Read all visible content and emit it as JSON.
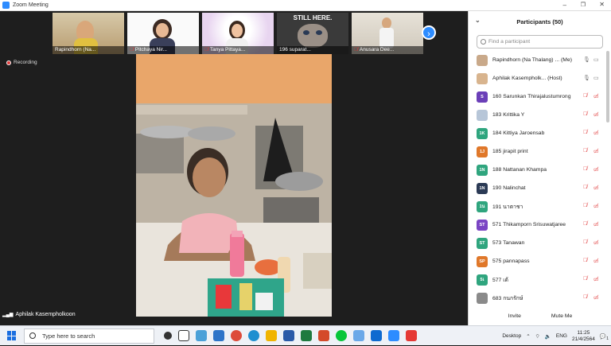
{
  "window": {
    "title": "Zoom Meeting"
  },
  "thumbnails": [
    {
      "name": "Rapindhorn (Na...",
      "muted": false
    },
    {
      "name": "Pitchaya Nir...",
      "muted": true
    },
    {
      "name": "Tanya Pittaya...",
      "muted": true
    },
    {
      "name": "196 suparat...",
      "muted": true,
      "overlay": "STILL HERE."
    },
    {
      "name": "Anusara Dee...",
      "muted": true
    }
  ],
  "recording_label": "Recording",
  "active_speaker": "Aphilak Kasempholkoon",
  "participants": {
    "title": "Participants (50)",
    "search_placeholder": "Find a participant",
    "invite_label": "Invite",
    "mute_me_label": "Mute Me",
    "items": [
      {
        "initials": "",
        "name": "Rapindhorn (Na Thalang) ... (Me)",
        "color": "#c9a98a",
        "mic": "on"
      },
      {
        "initials": "",
        "name": "Aphilak Kasempholk... (Host)",
        "color": "#d8b48e",
        "mic": "on"
      },
      {
        "initials": "S",
        "name": "160 Sarunkan Thirajalustumrong",
        "color": "#6b3fb8",
        "mic": "off"
      },
      {
        "initials": "",
        "name": "183 Krittika Y",
        "color": "#b7c6d8",
        "mic": "off"
      },
      {
        "initials": "1K",
        "name": "184 Kittiya Jaroensab",
        "color": "#2fa57e",
        "mic": "off"
      },
      {
        "initials": "1J",
        "name": "185 jirapit print",
        "color": "#e0782a",
        "mic": "off"
      },
      {
        "initials": "1N",
        "name": "188 Nattanan Khampa",
        "color": "#2fa57e",
        "mic": "off"
      },
      {
        "initials": "1N",
        "name": "190 Nalinchat",
        "color": "#2b3a55",
        "mic": "off"
      },
      {
        "initials": "1น",
        "name": "191 นาตาชา",
        "color": "#2fa57e",
        "mic": "off"
      },
      {
        "initials": "ST",
        "name": "571 Thikamporn Srisuwatjaree",
        "color": "#7a45c4",
        "mic": "off"
      },
      {
        "initials": "ST",
        "name": "573 Tanawan",
        "color": "#2fa57e",
        "mic": "off"
      },
      {
        "initials": "SP",
        "name": "575 pannapass",
        "color": "#e0782a",
        "mic": "off"
      },
      {
        "initials": "5เ",
        "name": "577 เต้",
        "color": "#2fa57e",
        "mic": "off"
      },
      {
        "initials": "",
        "name": "683 กนกรักษ์",
        "color": "#8a8a8a",
        "mic": "off"
      }
    ]
  },
  "taskbar": {
    "search_placeholder": "Type here to search",
    "desktop_label": "Desktop",
    "lang": "ENG",
    "time": "11:25",
    "date": "21/4/2564",
    "notifications": "1"
  }
}
